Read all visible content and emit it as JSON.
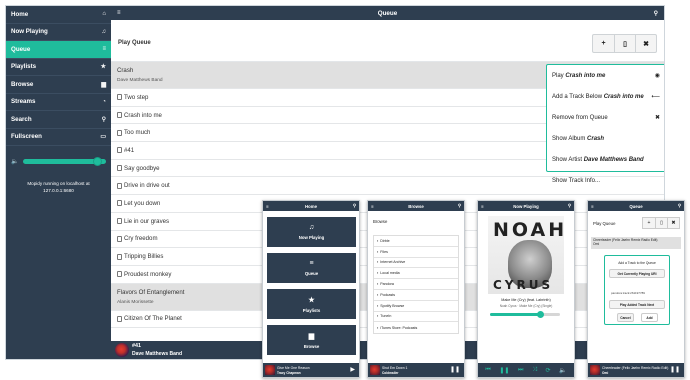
{
  "sidebar": {
    "items": [
      {
        "label": "Home",
        "icon": "home-icon",
        "glyph": "⌂"
      },
      {
        "label": "Now Playing",
        "icon": "music-icon",
        "glyph": "♫"
      },
      {
        "label": "Queue",
        "icon": "list-icon",
        "glyph": "≡"
      },
      {
        "label": "Playlists",
        "icon": "star-icon",
        "glyph": "★"
      },
      {
        "label": "Browse",
        "icon": "folder-icon",
        "glyph": "▆"
      },
      {
        "label": "Streams",
        "icon": "rss-icon",
        "glyph": "◔"
      },
      {
        "label": "Search",
        "icon": "search-icon",
        "glyph": "⚲"
      },
      {
        "label": "Fullscreen",
        "icon": "monitor-icon",
        "glyph": "▭"
      }
    ],
    "active_index": 2,
    "volume_level": 0.92,
    "status": "Mopidy running on localhost at 127.0.0.1:6680"
  },
  "header": {
    "title": "Queue"
  },
  "toolbar": {
    "title": "Play Queue",
    "buttons": [
      "+",
      "▯",
      "✖"
    ]
  },
  "queue": [
    {
      "title": "Crash",
      "artist": "Dave Matthews Band",
      "selected": true
    },
    {
      "title": "Two step"
    },
    {
      "title": "Crash into me"
    },
    {
      "title": "Too much"
    },
    {
      "title": "#41"
    },
    {
      "title": "Say goodbye"
    },
    {
      "title": "Drive in drive out"
    },
    {
      "title": "Let you down"
    },
    {
      "title": "Lie in our graves"
    },
    {
      "title": "Cry freedom"
    },
    {
      "title": "Tripping Billies"
    },
    {
      "title": "Proudest monkey"
    },
    {
      "title": "Flavors Of Entanglement",
      "artist": "Alanis Morissette",
      "selected": true
    },
    {
      "title": "Citizen Of The Planet"
    }
  ],
  "context_menu": [
    {
      "prefix": "Play ",
      "emph": "Crash into me",
      "icon": "play-circle-icon",
      "glyph": "◉"
    },
    {
      "prefix": "Add a Track Below ",
      "emph": "Crash into me",
      "icon": "insert-icon",
      "glyph": "⟵"
    },
    {
      "prefix": "Remove from Queue",
      "emph": "",
      "icon": "remove-icon",
      "glyph": "✖"
    },
    {
      "prefix": "Show Album ",
      "emph": "Crash",
      "icon": "",
      "glyph": ""
    },
    {
      "prefix": "Show Artist ",
      "emph": "Dave Matthews Band",
      "icon": "",
      "glyph": ""
    },
    {
      "prefix": "Show Track Info...",
      "emph": "",
      "icon": "",
      "glyph": ""
    }
  ],
  "nowbar": {
    "title": "#41",
    "artist": "Dave Matthews Band"
  },
  "phones": {
    "home": {
      "title": "Home",
      "tiles": [
        {
          "label": "Now Playing",
          "glyph": "♫"
        },
        {
          "label": "Queue",
          "glyph": "≡"
        },
        {
          "label": "Playlists",
          "glyph": "★"
        },
        {
          "label": "Browse",
          "glyph": "▆"
        }
      ],
      "np_title": "Give Me One Reason",
      "np_artist": "Tracy Chapman"
    },
    "browse": {
      "title": "Browse",
      "heading": "Browse",
      "items": [
        "Dirble",
        "Files",
        "Internet Archive",
        "Local media",
        "Pandora",
        "Podcasts",
        "Spotify Browse",
        "TuneIn",
        "iTunes Store: Podcasts"
      ],
      "np_title": "Shut Em Down 1",
      "np_artist": "Coldmailer"
    },
    "nowplaying": {
      "title": "Now Playing",
      "art_top": "NOAH",
      "art_bottom": "CYRUS",
      "track": "Make Me (Cry) (feat. Labrinth)",
      "sub": "Noah Cyrus · Make Me (Cry) (Single)",
      "progress": 0.72
    },
    "queue": {
      "title": "Queue",
      "heading": "Play Queue",
      "rows": [
        "Cheerleader (Felix Jaehn Remix Radio Edit)",
        "Omi"
      ],
      "dialog_title": "Add a Track to the Queue",
      "btn_current": "Get Currently Playing URI",
      "uri": "pandora:track:261197789",
      "btn_play": "Play Added Track Next",
      "cancel": "Cancel",
      "add": "Add",
      "np_title": "Cheerleader (Felix Jaehn Remix Radio Edit)",
      "np_artist": "Omi"
    }
  },
  "colors": {
    "sidebar": "#2e3e50",
    "accent": "#1fbc9c",
    "selected_row": "#e0e0e0"
  }
}
